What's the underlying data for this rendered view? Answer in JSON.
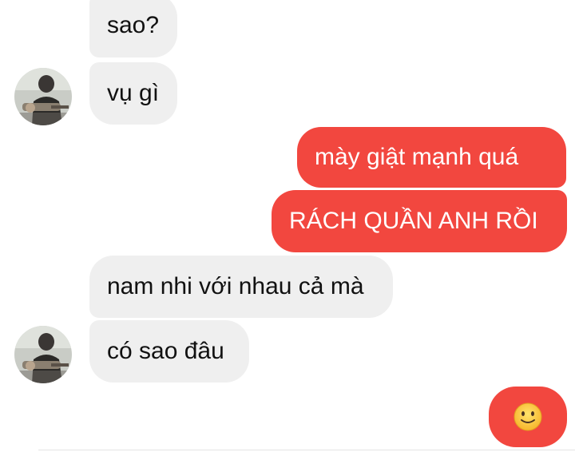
{
  "conversation": {
    "messages": [
      {
        "side": "incoming",
        "text": "sao?"
      },
      {
        "side": "incoming",
        "text": "vụ gì"
      },
      {
        "side": "outgoing",
        "text": "mày giật mạnh quá"
      },
      {
        "side": "outgoing",
        "text": "RÁCH QUẦN ANH RỒI"
      },
      {
        "side": "incoming",
        "text": "nam nhi với nhau cả mà"
      },
      {
        "side": "incoming",
        "text": "có sao đâu"
      },
      {
        "side": "outgoing",
        "emoji": "slightly-smiling-face-icon"
      }
    ]
  },
  "colors": {
    "incoming_bubble": "#efefef",
    "outgoing_bubble": "#f2473f",
    "incoming_text": "#111111",
    "outgoing_text": "#ffffff"
  }
}
